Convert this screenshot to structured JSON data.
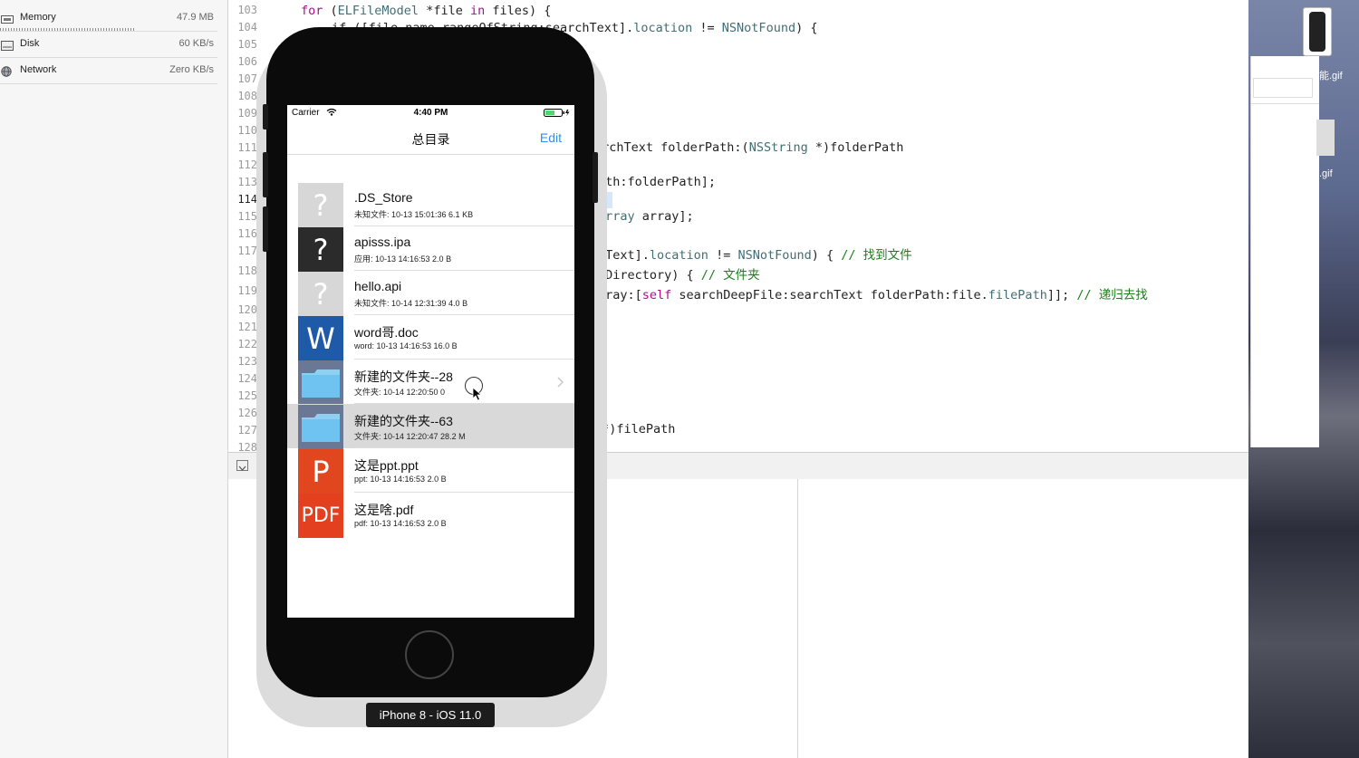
{
  "debug_navigator": {
    "gauges": [
      {
        "label": "Memory",
        "value": "47.9 MB"
      },
      {
        "label": "Disk",
        "value": "60 KB/s"
      },
      {
        "label": "Network",
        "value": "Zero KB/s"
      }
    ]
  },
  "editor": {
    "line_numbers": [
      "103",
      "104",
      "105",
      "106",
      "107",
      "108",
      "109",
      "110",
      "111",
      "112",
      "113",
      "114",
      "115",
      "116",
      "117",
      "118",
      "119",
      "120",
      "121",
      "122",
      "123",
      "124",
      "125",
      "126",
      "127",
      "128"
    ],
    "current_line": "114",
    "snippets": {
      "l103_kw": "for",
      "l103_a": " (",
      "l103_type": "ELFileModel",
      "l103_b": " *file ",
      "l103_in": "in",
      "l103_c": " files) {",
      "l104_a": "if ([file.name rangeOfString:searchText].",
      "l104_prop": "location",
      "l104_b": " != ",
      "l104_const": "NSNotFound",
      "l104_c": ") {",
      "l111_a": "archText folderPath:(",
      "l111_type": "NSString",
      "l111_b": " *)folderPath",
      "l113": "ath:folderPath];",
      "l115_type": "Array",
      "l115_b": " array];",
      "l117_a": "hText].",
      "l117_prop": "location",
      "l117_b": " != ",
      "l117_const": "NSNotFound",
      "l117_c": ") { ",
      "l117_cm": "// 找到文件",
      "l118_a": "eDirectory) { ",
      "l118_cm": "// 文件夹",
      "l119_a": "rray:[",
      "l119_kw": "self",
      "l119_b": " searchDeepFile:searchText folderPath:file.",
      "l119_prop": "filePath",
      "l119_c": "]]; ",
      "l119_cm": "// 递归去找",
      "l127": " *)filePath"
    }
  },
  "debug_bar": {
    "tab_fragment": "mo"
  },
  "desktop": {
    "file1": "能.gif",
    "file2": ".gif"
  },
  "simulator": {
    "device_label": "iPhone 8 - iOS 11.0",
    "status": {
      "carrier": "Carrier",
      "time": "4:40 PM"
    },
    "nav": {
      "title": "总目录",
      "edit": "Edit"
    },
    "files": [
      {
        "name": ".DS_Store",
        "meta": "未知文件:   10-13 15:01:36 6.1 KB",
        "icon": "unknown-file-icon",
        "glyph": "?",
        "color": "#d7d7d7"
      },
      {
        "name": "apisss.ipa",
        "meta": "应用:   10-13 14:16:53 2.0 B",
        "icon": "app-file-icon",
        "glyph": "?",
        "color": "#2b2b2b"
      },
      {
        "name": "hello.api",
        "meta": "未知文件:   10-14 12:31:39 4.0 B",
        "icon": "unknown-file-icon",
        "glyph": "?",
        "color": "#d7d7d7"
      },
      {
        "name": "word哥.doc",
        "meta": "word:   10-13 14:16:53 16.0 B",
        "icon": "word-doc-icon",
        "glyph": "W",
        "color": "#1e5aa8"
      },
      {
        "name": "新建的文件夹--28",
        "meta": "文件夹:   10-14 12:20:50 0",
        "icon": "folder-icon",
        "glyph": "",
        "color": "#6a7895"
      },
      {
        "name": "新建的文件夹--63",
        "meta": "文件夹:   10-14 12:20:47 28.2 M",
        "icon": "folder-icon",
        "glyph": "",
        "color": "#6a7895"
      },
      {
        "name": "这是ppt.ppt",
        "meta": "ppt:   10-13 14:16:53 2.0 B",
        "icon": "ppt-file-icon",
        "glyph": "P",
        "color": "#e2461f"
      },
      {
        "name": "这是啥.pdf",
        "meta": "pdf:   10-13 14:16:53 2.0 B",
        "icon": "pdf-file-icon",
        "glyph": "PDF",
        "color": "#e2401e"
      }
    ]
  }
}
